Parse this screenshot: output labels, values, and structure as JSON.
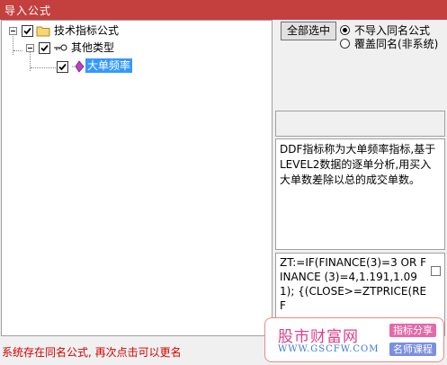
{
  "window": {
    "title": "导入公式",
    "title_bar_color": "#c4403f"
  },
  "tree": {
    "root": {
      "label": "技术指标公式",
      "checked": true,
      "icon": "folder-icon"
    },
    "group": {
      "label": "其他类型",
      "checked": true,
      "icon": "key-icon"
    },
    "leaf": {
      "label": "大单频率",
      "checked": true,
      "icon": "formula-icon",
      "selected": true
    }
  },
  "actions": {
    "select_all_label": "全部选中",
    "radio_options": [
      {
        "label": "不导入同名公式",
        "selected": true
      },
      {
        "label": "覆盖同名(非系统)",
        "selected": false
      }
    ]
  },
  "description": "DDF指标称为大单频率指标,基于LEVEL2数据的逐单分析,用买入大单数差除以总的成交单数。",
  "formula_code": "ZT:=IF(FINANCE(3)=3 OR FINANCE (3)=4,1.191,1.091); {(CLOSE>=ZTPRICE(REF",
  "status_message": "系统存在同名公式, 再次点击可以更名",
  "watermark": {
    "brand": "股市财富网",
    "url": "WWW.GSCFW.COM",
    "tag1": "指标分享",
    "tag2": "名师课程"
  }
}
